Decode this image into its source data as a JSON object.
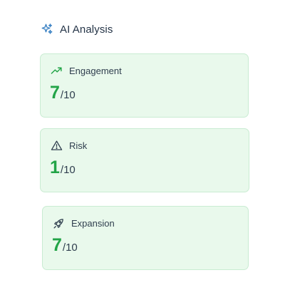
{
  "header": {
    "title": "AI Analysis",
    "icon": "sparkles-icon"
  },
  "colors": {
    "accent_green": "#22a447",
    "card_background": "#e9f9ec",
    "card_border": "#c9ecd2",
    "header_icon": "#3b82c4"
  },
  "cards": [
    {
      "label": "Engagement",
      "icon": "trending-up-icon",
      "score": "7",
      "max": "/10"
    },
    {
      "label": "Risk",
      "icon": "warning-triangle-icon",
      "score": "1",
      "max": "/10"
    },
    {
      "label": "Expansion",
      "icon": "rocket-icon",
      "score": "7",
      "max": "/10"
    }
  ]
}
